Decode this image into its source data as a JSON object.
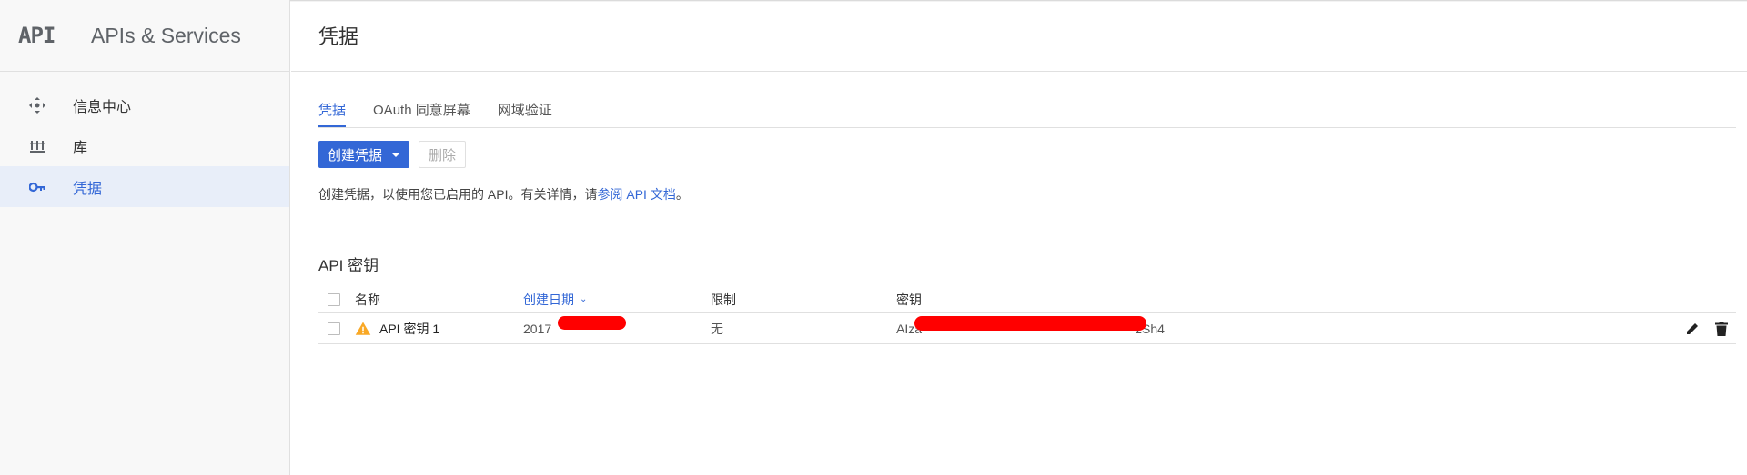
{
  "sidebar": {
    "logo": "API",
    "title": "APIs & Services",
    "items": [
      {
        "label": "信息中心",
        "icon": "dashboard-icon"
      },
      {
        "label": "库",
        "icon": "library-icon"
      },
      {
        "label": "凭据",
        "icon": "key-icon",
        "active": true
      }
    ]
  },
  "header": {
    "title": "凭据"
  },
  "tabs": [
    {
      "label": "凭据",
      "active": true
    },
    {
      "label": "OAuth 同意屏幕"
    },
    {
      "label": "网域验证"
    }
  ],
  "toolbar": {
    "create_label": "创建凭据",
    "delete_label": "删除"
  },
  "description": {
    "text": "创建凭据，以使用您已启用的 API。有关详情，请",
    "link": "参阅 API 文档",
    "suffix": "。"
  },
  "api_keys": {
    "title": "API 密钥",
    "columns": {
      "name": "名称",
      "date": "创建日期",
      "limit": "限制",
      "key": "密钥"
    },
    "rows": [
      {
        "name": "API 密钥 1",
        "date": "2017",
        "limit": "无",
        "key_prefix": "AIza",
        "key_suffix": "zSh4"
      }
    ]
  },
  "colors": {
    "accent": "#3367d6",
    "warning": "#f9a825",
    "redaction": "#ff0000"
  }
}
